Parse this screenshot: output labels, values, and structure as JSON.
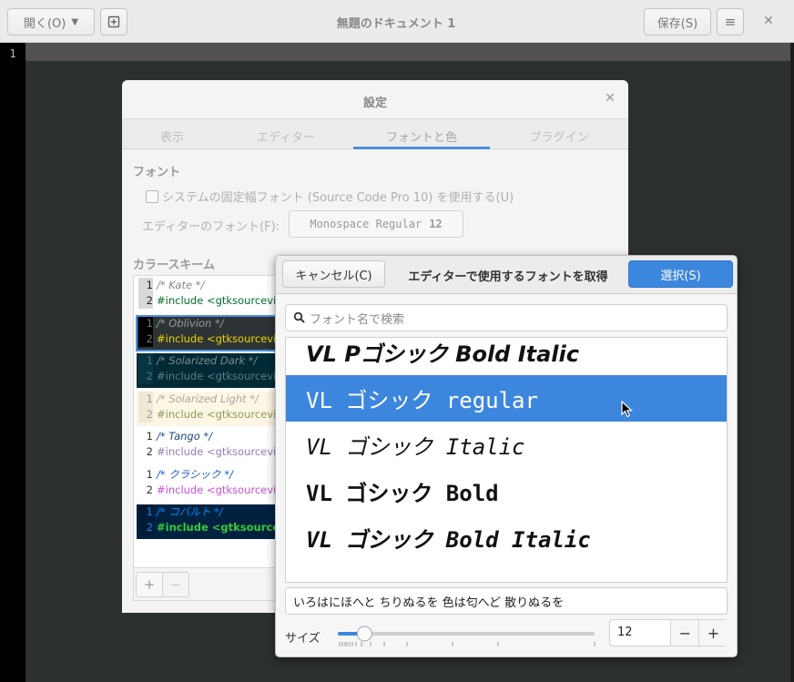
{
  "window": {
    "open_label": "開く(O)",
    "title": "無題のドキュメント 1",
    "save_label": "保存(S)"
  },
  "editor": {
    "line_number": "1"
  },
  "prefs": {
    "title": "設定",
    "tabs": [
      "表示",
      "エディター",
      "フォントと色",
      "プラグイン"
    ],
    "active_tab": "フォントと色",
    "font_heading": "フォント",
    "system_font_checkbox": "システムの固定幅フォント (Source Code Pro 10) を使用する(U)",
    "editor_font_label": "エディターのフォント(F):",
    "editor_font_name": "Monospace Regular",
    "editor_font_size": "12",
    "color_heading": "カラースキーム",
    "schemes": [
      {
        "name": "/* Kate */",
        "code": "#include <gtksourcevi",
        "bg": "#ffffff",
        "num_bg": "#d8d8d8",
        "c1": "#888888",
        "c2": "#006e28",
        "num": "#222222"
      },
      {
        "name": "/* Oblivion */",
        "code": "#include <gtksourcevi",
        "bg": "#2e3436",
        "num_bg": "#000000",
        "c1": "#9a9a9a",
        "c2": "#edd400",
        "num": "#777777",
        "prefix": "#include ",
        "prefix_color": "#ad7fa8"
      },
      {
        "name": "/* Solarized Dark */",
        "code": "#include <gtksourcevi",
        "bg": "#002b36",
        "num_bg": "#073642",
        "c1": "#7a8d8f",
        "c2": "#5f7c82",
        "num": "#586e75"
      },
      {
        "name": "/* Solarized Light */",
        "code": "#include <gtksourcevi",
        "bg": "#fdf6e3",
        "num_bg": "#eee8d5",
        "c1": "#a8a8a0",
        "c2": "#8a9c5c",
        "num": "#93a1a1"
      },
      {
        "name": "/* Tango */",
        "code": "#include <gtksourcevi",
        "bg": "#ffffff",
        "num_bg": "#ffffff",
        "c1": "#204a87",
        "c2": "#9a7ab7",
        "num": "#333333",
        "prefix": "#include ",
        "prefix_color": "#75507b"
      },
      {
        "name": "/* クラシック */",
        "code": "#include <gtksourcevi",
        "bg": "#ffffff",
        "num_bg": "#ffffff",
        "c1": "#1a56d0",
        "c2": "#c64fd6",
        "num": "#333333",
        "prefix": "#include ",
        "prefix_color": "#a020f0"
      },
      {
        "name": "/* コバルト */",
        "code": "#include <gtksourcev",
        "bg": "#002240",
        "num_bg": "#001b33",
        "c1": "#0088ff",
        "c2": "#33cc33",
        "num": "#0088ff",
        "prefix": "#include ",
        "prefix_color": "#ffffff"
      }
    ],
    "add_label": "+",
    "remove_label": "−"
  },
  "chooser": {
    "cancel_label": "キャンセル(C)",
    "title": "エディターで使用するフォントを取得",
    "select_label": "選択(S)",
    "search_placeholder": "フォント名で検索",
    "fonts": [
      {
        "label": "VL Pゴシック Bold Italic",
        "style": "bold-italic-sans"
      },
      {
        "label": "VL ゴシック regular",
        "style": "mono",
        "selected": true
      },
      {
        "label": "VL ゴシック Italic",
        "style": "mono-italic"
      },
      {
        "label": "VL ゴシック Bold",
        "style": "mono-bold"
      },
      {
        "label": "VL ゴシック Bold Italic",
        "style": "mono-bold-italic"
      }
    ],
    "preview_text": "いろはにほへと ちりぬるを 色は匂へど 散りぬるを",
    "size_label": "サイズ",
    "size_value": "12",
    "size_minus": "−",
    "size_plus": "+",
    "slider_fraction": 0.09
  },
  "colors": {
    "accent": "#3d86dd"
  },
  "icons": [
    "new-document-icon",
    "hamburger-menu-icon",
    "close-icon",
    "search-icon",
    "chevron-down-icon",
    "mouse-pointer-icon"
  ]
}
